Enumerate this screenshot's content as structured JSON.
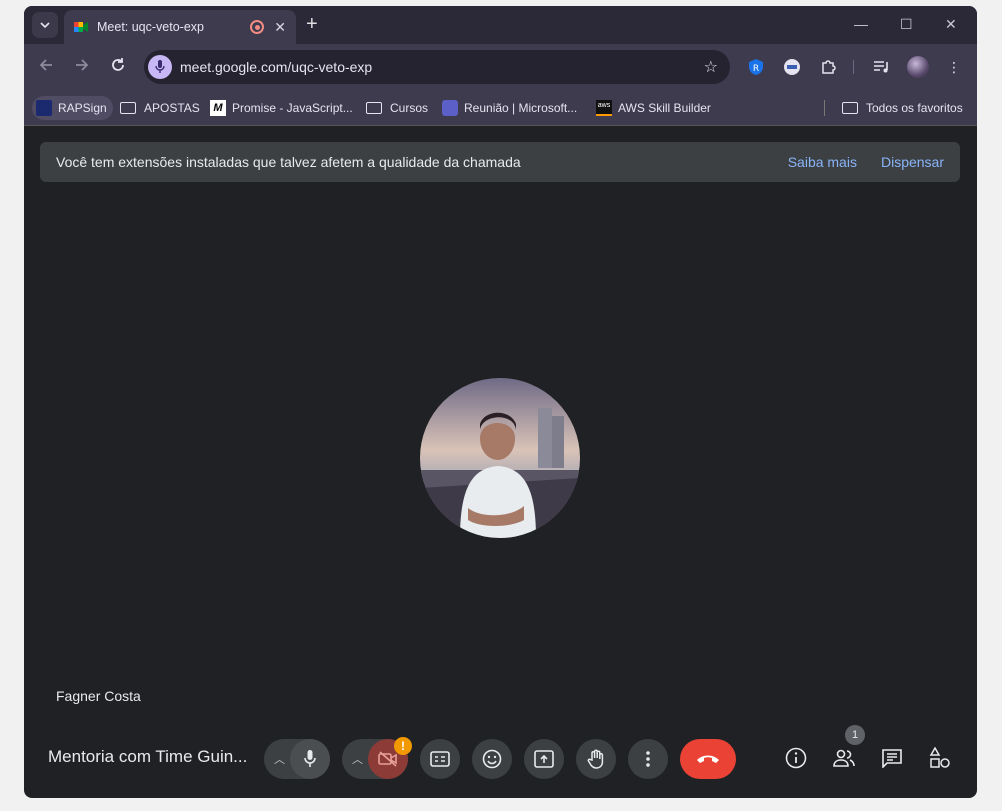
{
  "browser": {
    "tab": {
      "title": "Meet: uqc-veto-exp"
    },
    "url": "meet.google.com/uqc-veto-exp"
  },
  "bookmarks": [
    {
      "label": "RAPSign",
      "icon": "rapsign-icon"
    },
    {
      "label": "APOSTAS",
      "icon": "folder-icon"
    },
    {
      "label": "Promise - JavaScript...",
      "icon": "mdn-icon"
    },
    {
      "label": "Cursos",
      "icon": "folder-icon"
    },
    {
      "label": "Reunião | Microsoft...",
      "icon": "teams-icon"
    },
    {
      "label": "AWS Skill Builder",
      "icon": "aws-icon"
    }
  ],
  "all_bookmarks": "Todos os favoritos",
  "notice": {
    "message": "Você tem extensões instaladas que talvez afetem a qualidade da chamada",
    "learn_more": "Saiba mais",
    "dismiss": "Dispensar"
  },
  "participant": {
    "name": "Fagner Costa"
  },
  "meeting": {
    "title": "Mentoria com Time Guin..."
  },
  "people_count": "1",
  "warning_mark": "!",
  "colors": {
    "hangup": "#ea4335",
    "link": "#8ab4f8",
    "warning": "#f29900"
  }
}
